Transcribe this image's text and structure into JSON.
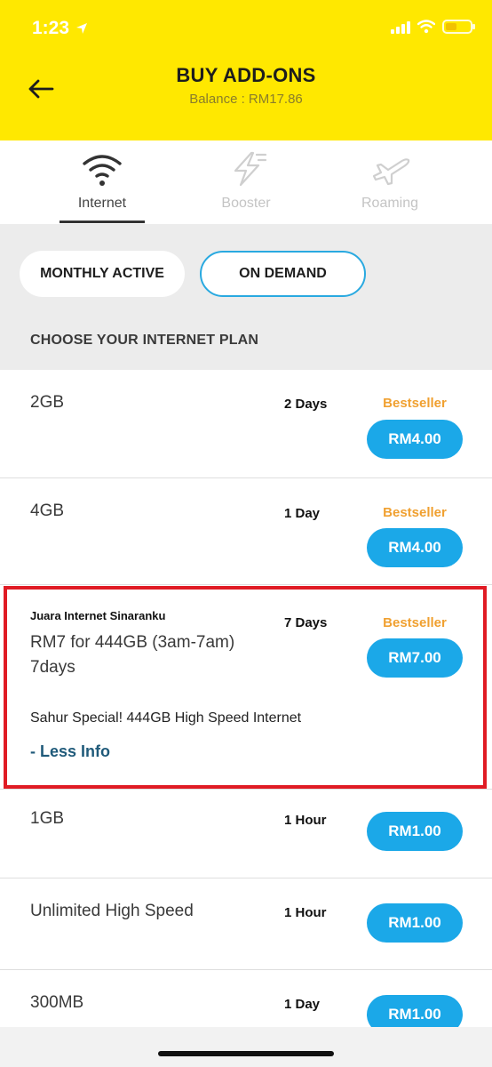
{
  "status_bar": {
    "time": "1:23"
  },
  "header": {
    "title": "BUY ADD-ONS",
    "balance": "Balance : RM17.86"
  },
  "tabs": [
    {
      "label": "Internet",
      "icon": "wifi-icon",
      "active": true
    },
    {
      "label": "Booster",
      "icon": "bolt-icon",
      "active": false
    },
    {
      "label": "Roaming",
      "icon": "airplane-icon",
      "active": false
    }
  ],
  "filters": {
    "monthly": "MONTHLY ACTIVE",
    "ondemand": "ON DEMAND",
    "selected": "ON DEMAND"
  },
  "section_title": "CHOOSE YOUR INTERNET PLAN",
  "plans": [
    {
      "name": "2GB",
      "duration": "2 Days",
      "badge": "Bestseller",
      "price": "RM4.00"
    },
    {
      "name": "4GB",
      "duration": "1 Day",
      "badge": "Bestseller",
      "price": "RM4.00"
    },
    {
      "subtitle": "Juara Internet Sinaranku",
      "name_line1": "RM7 for 444GB (3am-7am)",
      "name_line2": "7days",
      "duration": "7 Days",
      "badge": "Bestseller",
      "price": "RM7.00",
      "description": "Sahur Special! 444GB High Speed Internet",
      "toggle": "- Less Info"
    },
    {
      "name": "1GB",
      "duration": "1 Hour",
      "price": "RM1.00"
    },
    {
      "name": "Unlimited High Speed",
      "duration": "1 Hour",
      "price": "RM1.00"
    },
    {
      "name": "300MB",
      "duration": "1 Day",
      "price": "RM1.00"
    }
  ],
  "colors": {
    "header": "#ffe800",
    "accent": "#1ba8e8",
    "badge": "#f0a030",
    "highlight": "#e01b24"
  }
}
